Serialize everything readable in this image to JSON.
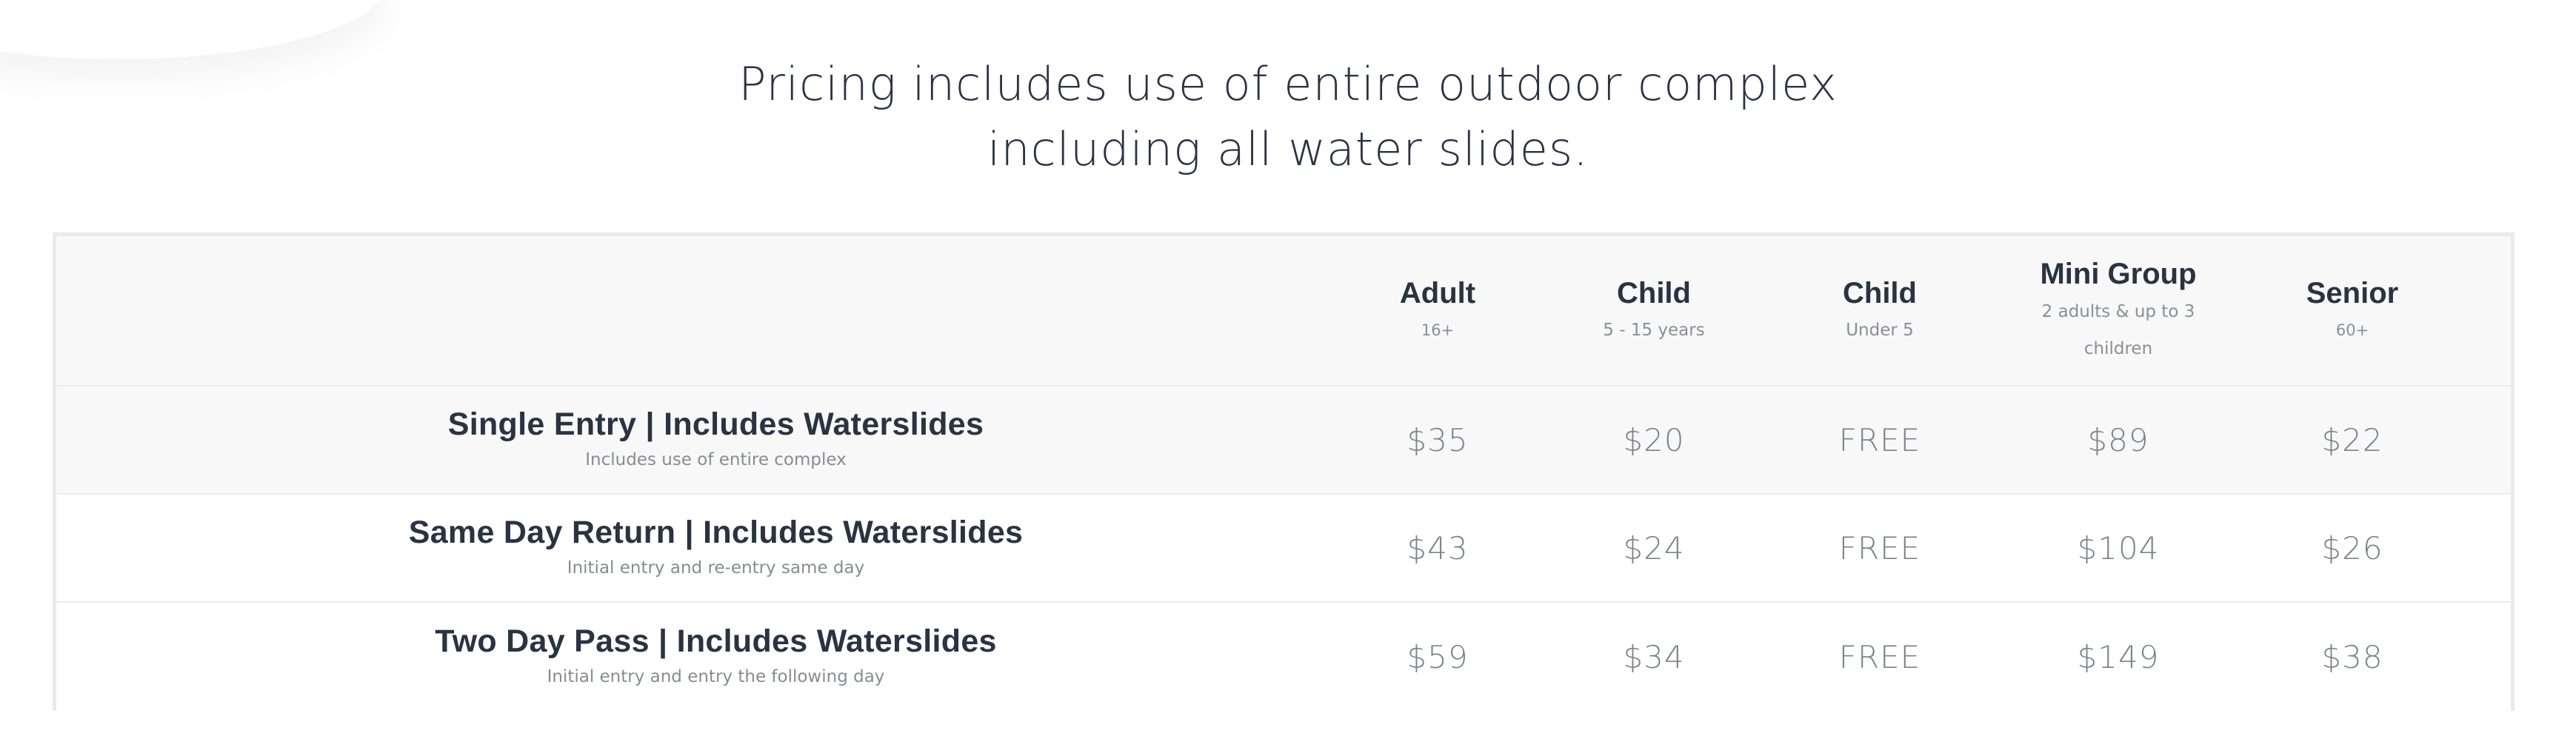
{
  "headline": {
    "line1": "Pricing includes use of entire outdoor complex",
    "line2": "including all water slides."
  },
  "pricing_table": {
    "columns": [
      {
        "title": "Adult",
        "subtitle": "16+"
      },
      {
        "title": "Child",
        "subtitle": "5 - 15 years"
      },
      {
        "title": "Child",
        "subtitle": "Under 5"
      },
      {
        "title": "Mini Group",
        "subtitle_line1": "2 adults & up to 3",
        "subtitle_line2": "children"
      },
      {
        "title": "Senior",
        "subtitle": "60+"
      }
    ],
    "rows": [
      {
        "title": "Single Entry | Includes Waterslides",
        "subtitle": "Includes use of entire complex",
        "prices": [
          "$35",
          "$20",
          "FREE",
          "$89",
          "$22"
        ]
      },
      {
        "title": "Same Day Return | Includes Waterslides",
        "subtitle": "Initial entry and re-entry same day",
        "prices": [
          "$43",
          "$24",
          "FREE",
          "$104",
          "$26"
        ]
      },
      {
        "title": "Two Day Pass | Includes Waterslides",
        "subtitle": "Initial entry and entry the following day",
        "prices": [
          "$59",
          "$34",
          "FREE",
          "$149",
          "$38"
        ]
      }
    ]
  },
  "colors": {
    "text_dark": "#2a3342",
    "text_muted": "#878c93",
    "price_text": "#7c828a",
    "header_bg": "#f8f8f8",
    "border": "#e9eaeb"
  }
}
